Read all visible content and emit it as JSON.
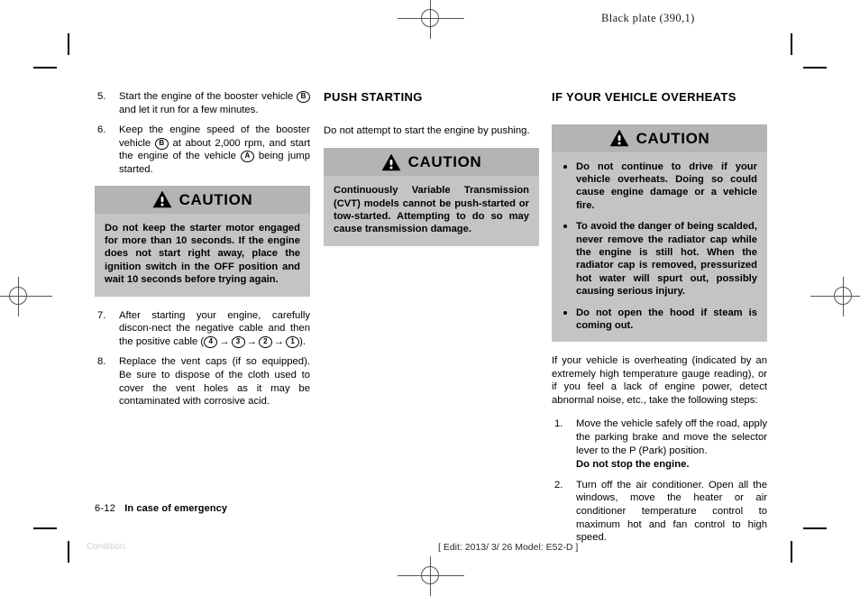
{
  "page": {
    "plate_header": "Black plate (390,1)",
    "footer_page_number": "6-12",
    "footer_section": "In case of emergency",
    "footer_condition": "Condition:",
    "footer_edit": "[ Edit: 2013/ 3/ 26   Model: E52-D ]"
  },
  "left_column": {
    "steps": [
      {
        "marker": "5.",
        "parts": [
          {
            "type": "text",
            "value": "Start the engine of the booster vehicle "
          },
          {
            "type": "circle",
            "value": "B"
          },
          {
            "type": "text",
            "value": " and let it run for a few minutes."
          }
        ]
      },
      {
        "marker": "6.",
        "parts": [
          {
            "type": "text",
            "value": "Keep the engine speed of the booster vehicle "
          },
          {
            "type": "circle",
            "value": "B"
          },
          {
            "type": "text",
            "value": " at about 2,000 rpm, and start the engine of the vehicle "
          },
          {
            "type": "circle",
            "value": "A"
          },
          {
            "type": "text",
            "value": " being jump started."
          }
        ]
      }
    ],
    "caution": {
      "title": "CAUTION",
      "icon": "warning-triangle-icon",
      "body": "Do not keep the starter motor engaged for more than 10 seconds. If the engine does not start right away, place the ignition switch in the OFF position and wait 10 seconds before trying again."
    },
    "steps_after": [
      {
        "marker": "7.",
        "parts": [
          {
            "type": "text",
            "value": "After starting your engine, carefully discon-nect the negative cable and then the positive cable ("
          },
          {
            "type": "circle",
            "value": "4"
          },
          {
            "type": "arrow",
            "value": "→"
          },
          {
            "type": "circle",
            "value": "3"
          },
          {
            "type": "arrow",
            "value": "→"
          },
          {
            "type": "circle",
            "value": "2"
          },
          {
            "type": "arrow",
            "value": "→"
          },
          {
            "type": "circle",
            "value": "1"
          },
          {
            "type": "text",
            "value": ")."
          }
        ]
      },
      {
        "marker": "8.",
        "parts": [
          {
            "type": "text",
            "value": "Replace the vent caps (if so equipped). Be sure to dispose of the cloth used to cover the vent holes as it may be contaminated with corrosive acid."
          }
        ]
      }
    ]
  },
  "middle_column": {
    "heading": "PUSH STARTING",
    "intro": "Do not attempt to start the engine by pushing.",
    "caution": {
      "title": "CAUTION",
      "icon": "warning-triangle-icon",
      "body": "Continuously Variable Transmission (CVT) models cannot be push-started or tow-started. Attempting to do so may cause transmission damage."
    }
  },
  "right_column": {
    "heading": "IF YOUR VEHICLE OVERHEATS",
    "caution": {
      "title": "CAUTION",
      "icon": "warning-triangle-icon",
      "bullets": [
        "Do not continue to drive if your vehicle overheats. Doing so could cause engine damage or a vehicle fire.",
        "To avoid the danger of being scalded, never remove the radiator cap while the engine is still hot. When the radiator cap is removed, pressurized hot water will spurt out, possibly causing serious injury.",
        "Do not open the hood if steam is coming out."
      ]
    },
    "intro": "If your vehicle is overheating (indicated by an extremely high temperature gauge reading), or if you feel a lack of engine power, detect abnormal noise, etc., take the following steps:",
    "steps": [
      {
        "marker": "1.",
        "text": "Move the vehicle safely off the road, apply the parking brake and move the selector lever to the P (Park) position.",
        "bold_note": "Do not stop the engine."
      },
      {
        "marker": "2.",
        "text": "Turn off the air conditioner. Open all the windows, move the heater or air conditioner temperature control to maximum hot and fan control to high speed.",
        "bold_note": ""
      }
    ]
  },
  "colors": {
    "caution_header_bg": "#b4b4b4",
    "caution_body_bg": "#c4c4c4",
    "text": "#000000",
    "condition_text": "#d2d2d2"
  }
}
